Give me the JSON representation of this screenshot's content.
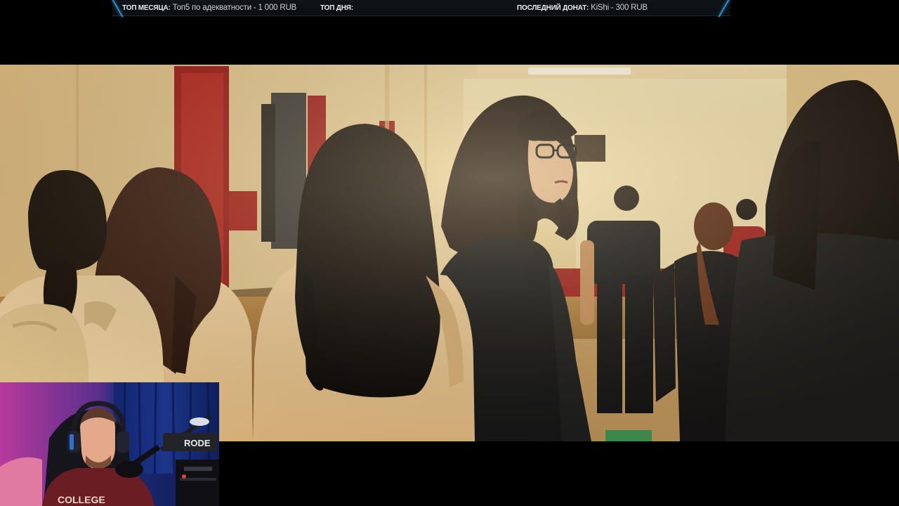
{
  "ticker": {
    "month_label": "ТОП МЕСЯЦА:",
    "month_value": "Топ5 по адекватности - 1 000 RUB",
    "day_label": "ТОП ДНЯ:",
    "day_value": "",
    "donate_label": "ПОСЛЕДНИЙ ДОНАТ:",
    "donate_value": "KiShi - 300 RUB"
  },
  "webcam": {
    "mic_brand": "RODE",
    "shirt_text": "COLLEGE"
  },
  "colors": {
    "ticker_bg": "#0e1419",
    "ticker_accent": "#2f97d6",
    "hall_wall": "#e8c98e",
    "hall_door": "#a3201a"
  }
}
